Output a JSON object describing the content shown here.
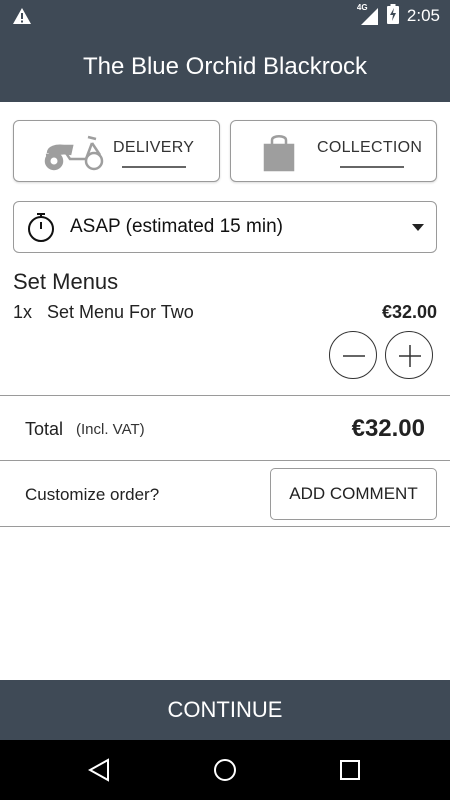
{
  "status_bar": {
    "network": "4G",
    "time": "2:05"
  },
  "header": {
    "title": "The Blue Orchid Blackrock"
  },
  "order_mode": {
    "delivery_label": "DELIVERY",
    "collection_label": "COLLECTION"
  },
  "time_select": {
    "value": "ASAP (estimated 15 min)"
  },
  "cart": {
    "section_title": "Set Menus",
    "items": [
      {
        "qty": "1x",
        "name": "Set Menu For Two",
        "price": "€32.00"
      }
    ]
  },
  "total": {
    "label": "Total",
    "vat_note": "(Incl. VAT)",
    "value": "€32.00"
  },
  "customize": {
    "label": "Customize order?",
    "button_label": "ADD COMMENT"
  },
  "footer": {
    "continue_label": "CONTINUE"
  },
  "colors": {
    "bar": "#3f4a56",
    "border": "#9a9a9a",
    "icon_gray": "#9e9e9e"
  }
}
